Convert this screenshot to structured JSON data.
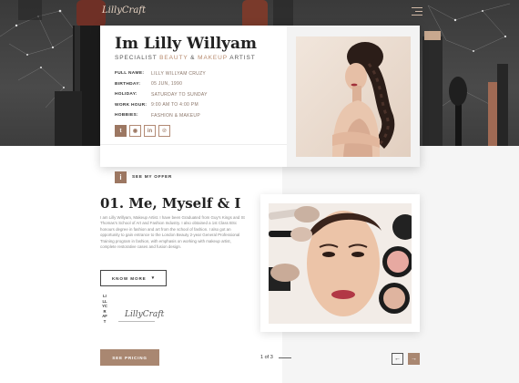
{
  "hero": {
    "logo_text": "LillyCraft"
  },
  "profile": {
    "name": "Im Lilly Willyam",
    "role_prefix": "SPECIALIST ",
    "role_accent_1": "BEAUTY",
    "role_joiner": " & ",
    "role_accent_2": "MAKEUP",
    "role_suffix": " ARTIST",
    "info": [
      {
        "label": "FULL NAME:",
        "value": "LILLY WILLYAM CRUZY"
      },
      {
        "label": "BIRTHDAY:",
        "value": "05 JUN, 1990"
      },
      {
        "label": "HOLIDAY:",
        "value": "SATURDAY TO SUNDAY"
      },
      {
        "label": "WORK HOUR:",
        "value": "9:00 AM TO 4:00 PM"
      },
      {
        "label": "HOBBIES:",
        "value": "FASHION & MAKEUP"
      }
    ],
    "socials": [
      {
        "name": "twitter",
        "glyph": "t"
      },
      {
        "name": "github",
        "glyph": "◉"
      },
      {
        "name": "linkedin",
        "glyph": "in"
      },
      {
        "name": "pinterest",
        "glyph": "℗"
      }
    ],
    "offer_icon": "i",
    "offer_label": "SEE MY OFFER"
  },
  "about": {
    "title": "01. Me, Myself & I",
    "text": "I am Lilly Willyam, Makeup Artist. I have been Graduated from Guy's Kings and St Thomas's School of Art and Fashion Industry. I also obtained a 1st Class BSc honours degree in fashion and art from the school of fashion. I also got an opportunity to gain entrance to the London Beauty 2-year General Professional Training program in fashion, with emphasis on working with makeup artist, complete restorative cases and fusion design.",
    "know_more_label": "KNOW MORE",
    "know_more_icon": "▾",
    "vertical_brand": "LILLYCRAFT",
    "signature": "LillyCraft",
    "pricing_label": "SEE PRICING"
  },
  "pager": {
    "text": "1 of 3",
    "prev_icon": "←",
    "next_icon": "→"
  }
}
